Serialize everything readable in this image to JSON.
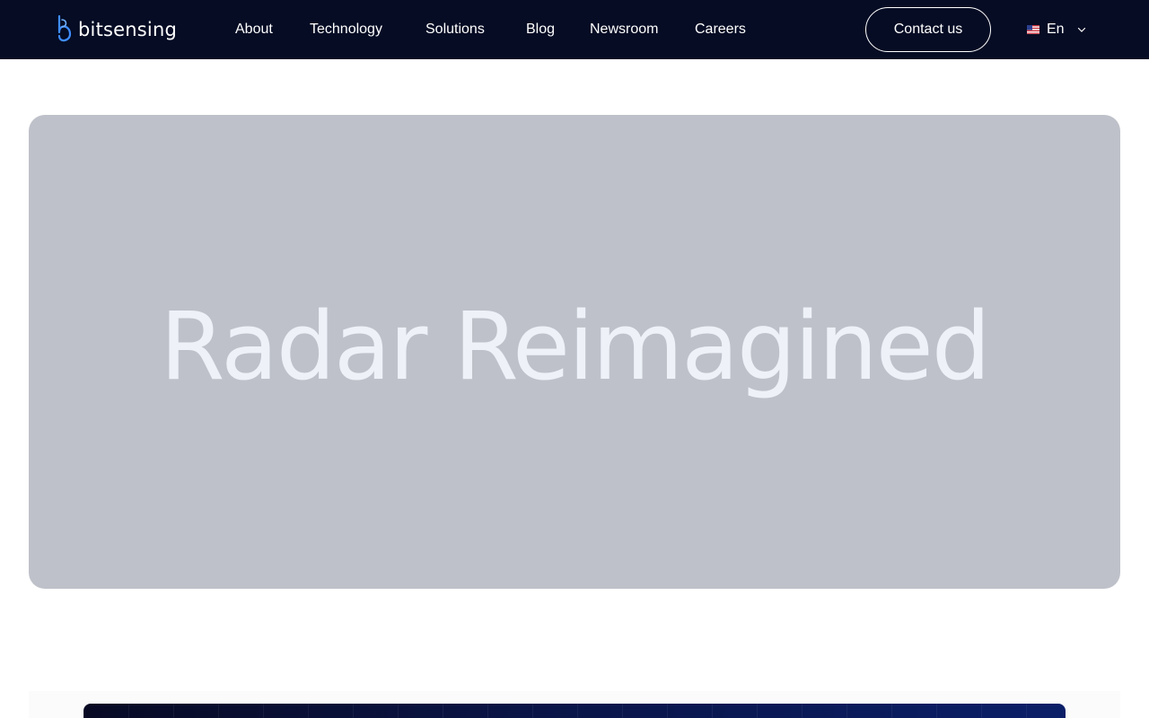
{
  "header": {
    "logo_text": "bitsensing",
    "nav": [
      {
        "label": "About"
      },
      {
        "label": "Technology"
      },
      {
        "label": "Solutions"
      },
      {
        "label": "Blog"
      },
      {
        "label": "Newsroom"
      },
      {
        "label": "Careers"
      }
    ],
    "contact_label": "Contact us",
    "language": {
      "label": "En",
      "flag_icon": "us-flag-icon"
    }
  },
  "hero": {
    "title": "Radar Reimagined"
  },
  "colors": {
    "header_bg": "#050c24",
    "hero_bg": "#bec1c9",
    "hero_text": "#eef1f8",
    "logo_accent": "#3f8dff"
  }
}
